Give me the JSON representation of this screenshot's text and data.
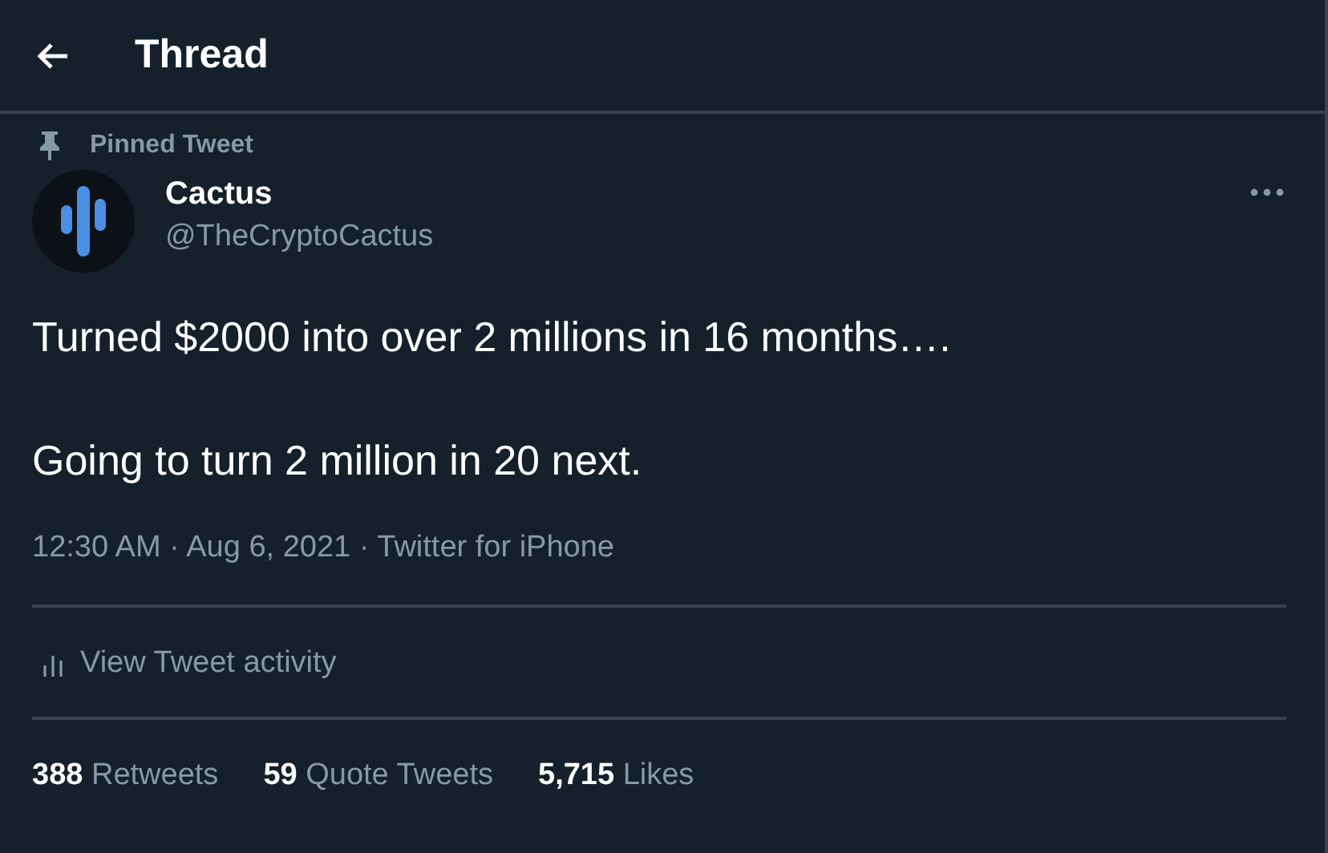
{
  "header": {
    "title": "Thread"
  },
  "pinned": {
    "label": "Pinned Tweet"
  },
  "tweet": {
    "name": "Cactus",
    "handle": "@TheCryptoCactus",
    "paragraphs": [
      "Turned $2000 into over 2 millions in 16 months….",
      "Going to turn 2 million in 20 next."
    ],
    "meta": "12:30 AM · Aug 6, 2021 · Twitter for iPhone",
    "activity": "View Tweet activity",
    "stats": [
      {
        "count": "388",
        "label": "Retweets"
      },
      {
        "count": "59",
        "label": "Quote Tweets"
      },
      {
        "count": "5,715",
        "label": "Likes"
      }
    ]
  }
}
